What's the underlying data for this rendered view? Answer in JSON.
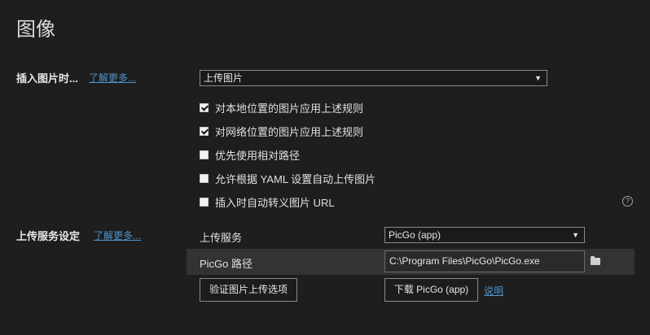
{
  "header": {
    "title": "图像"
  },
  "insert_section": {
    "label": "插入图片时...",
    "learn_more": "了解更多...",
    "select_value": "上传图片",
    "checkboxes": [
      {
        "label": "对本地位置的图片应用上述规则",
        "checked": true
      },
      {
        "label": "对网络位置的图片应用上述规则",
        "checked": true
      },
      {
        "label": "优先使用相对路径",
        "checked": false
      },
      {
        "label": "允许根据 YAML 设置自动上传图片",
        "checked": false
      },
      {
        "label": "插入时自动转义图片 URL",
        "checked": false
      }
    ],
    "help_icon": "?"
  },
  "upload_section": {
    "label": "上传服务设定",
    "learn_more": "了解更多...",
    "service_label": "上传服务",
    "service_value": "PicGo (app)",
    "path_label": "PicGo 路径",
    "path_value": "C:\\Program Files\\PicGo\\PicGo.exe",
    "verify_button": "验证图片上传选项",
    "download_button": "下载 PicGo (app)",
    "explain_link": "说明"
  },
  "icons": {
    "folder": "folder-icon",
    "help": "question-circle-icon",
    "dropdown": "chevron-down-icon"
  }
}
